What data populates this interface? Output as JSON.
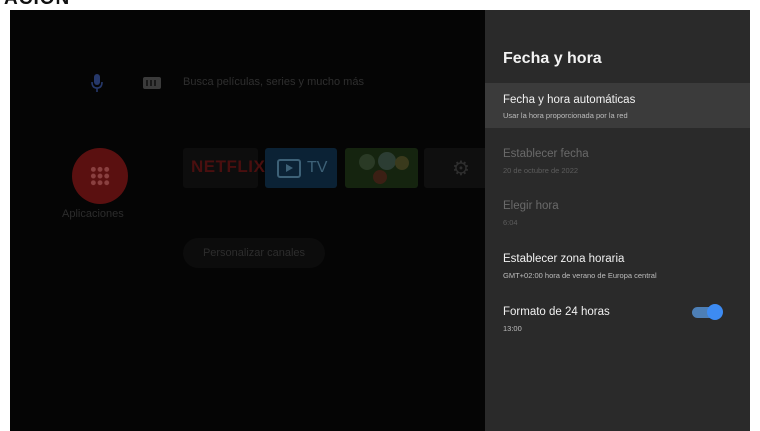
{
  "header": {
    "cropped_text": "ACIÓN"
  },
  "home": {
    "search_placeholder": "Busca películas, series y mucho más",
    "apps_label": "Aplicaciones",
    "tiles": {
      "netflix": "NETFLIX",
      "tv": "TV"
    },
    "personalize_label": "Personalizar canales"
  },
  "panel": {
    "title": "Fecha y hora",
    "items": [
      {
        "label": "Fecha y hora automáticas",
        "sub": "Usar la hora proporcionada por la red",
        "state": "focused"
      },
      {
        "label": "Establecer fecha",
        "sub": "20 de octubre de 2022",
        "state": "disabled"
      },
      {
        "label": "Elegir hora",
        "sub": "6:04",
        "state": "disabled"
      },
      {
        "label": "Establecer zona horaria",
        "sub": "GMT+02:00 hora de verano de Europa central",
        "state": "enabled"
      },
      {
        "label": "Formato de 24 horas",
        "sub": "13:00",
        "state": "enabled",
        "toggle_on": true
      }
    ]
  },
  "colors": {
    "panel_bg": "#2a2a2a",
    "focus_bg": "#3b3b3b",
    "toggle_accent": "#3d8bf2"
  }
}
